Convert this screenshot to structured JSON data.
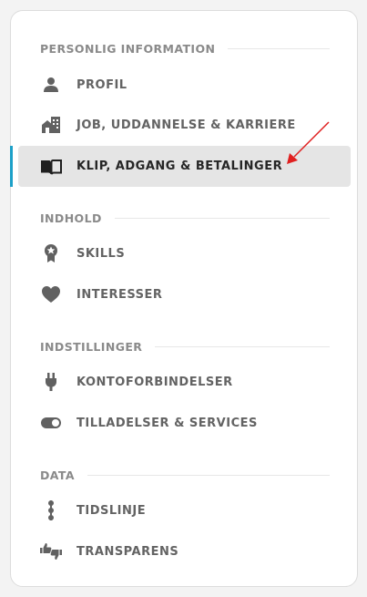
{
  "sections": [
    {
      "title": "PERSONLIG INFORMATION",
      "items": [
        {
          "label": "PROFIL",
          "icon": "user-icon"
        },
        {
          "label": "JOB, UDDANNELSE & KARRIERE",
          "icon": "building-icon"
        },
        {
          "label": "KLIP, ADGANG & BETALINGER",
          "icon": "open-book-icon",
          "active": true
        }
      ]
    },
    {
      "title": "INDHOLD",
      "items": [
        {
          "label": "SKILLS",
          "icon": "award-ribbon-icon"
        },
        {
          "label": "INTERESSER",
          "icon": "heart-icon"
        }
      ]
    },
    {
      "title": "INDSTILLINGER",
      "items": [
        {
          "label": "KONTOFORBINDELSER",
          "icon": "plug-icon"
        },
        {
          "label": "TILLADELSER & SERVICES",
          "icon": "toggle-icon"
        }
      ]
    },
    {
      "title": "DATA",
      "items": [
        {
          "label": "TIDSLINJE",
          "icon": "timeline-icon"
        },
        {
          "label": "TRANSPARENS",
          "icon": "thumbs-up-down-icon"
        }
      ]
    }
  ],
  "colors": {
    "accent": "#1ca0c8",
    "active_background": "#e5e5e5",
    "annotation_arrow": "#e02020"
  }
}
